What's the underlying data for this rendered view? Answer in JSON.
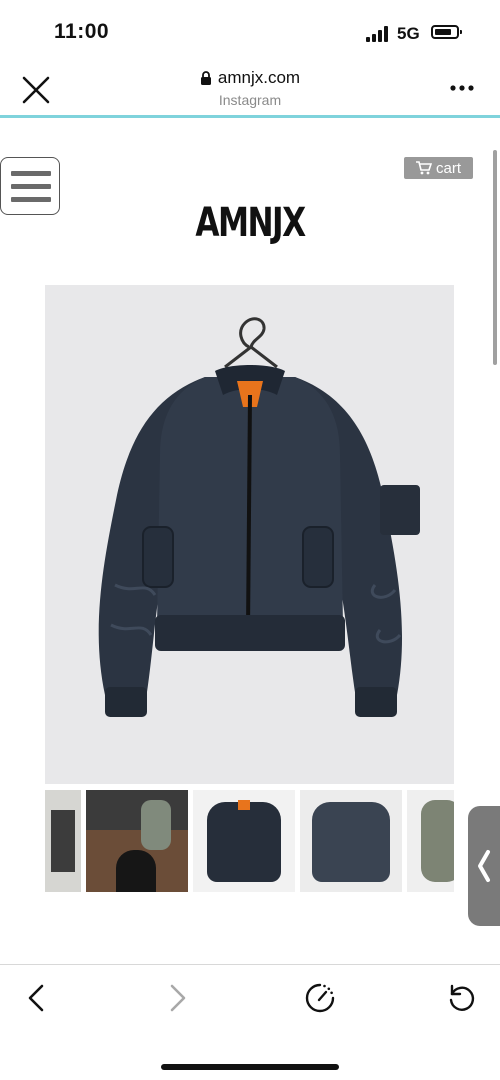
{
  "status_bar": {
    "time": "11:00",
    "network": "5G"
  },
  "browser": {
    "url": "amnjx.com",
    "source": "Instagram",
    "more_label": "•••",
    "icons": {
      "close": "close-icon",
      "lock": "lock-icon",
      "more": "more-icon"
    }
  },
  "page": {
    "menu_icon": "hamburger-menu-icon",
    "cart_label": "cart",
    "cart_icon": "shopping-cart-icon",
    "logo": "AMNJX",
    "product_image": "navy-bomber-jacket-on-hanger",
    "thumbnails": [
      "thumbnail-room-interior",
      "thumbnail-people-in-room",
      "thumbnail-jacket-front",
      "thumbnail-jacket-back",
      "thumbnail-jacket-green"
    ],
    "side_tab_icon": "chevron-left-icon"
  },
  "toolbar": {
    "back_icon": "back-arrow-icon",
    "forward_icon": "forward-arrow-icon",
    "speed_icon": "speedometer-icon",
    "reload_icon": "reload-icon"
  },
  "colors": {
    "accent_line": "#7fd3dc",
    "cart_bg": "#999999",
    "jacket": "#2b3442",
    "lining": "#e8741c"
  }
}
